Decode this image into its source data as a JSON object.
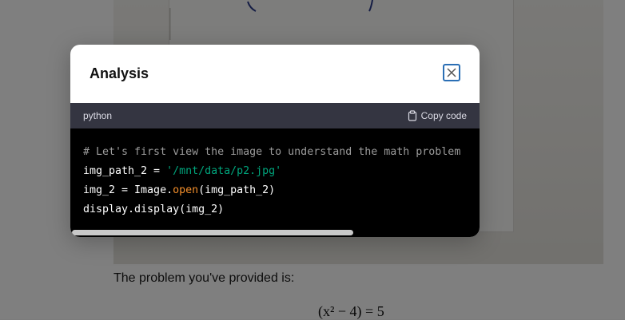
{
  "background": {
    "paragraph": "The problem you've provided is:",
    "math": "(x² − 4) = 5"
  },
  "modal": {
    "title": "Analysis",
    "close_icon": "close-icon"
  },
  "code_block": {
    "language": "python",
    "copy_label": "Copy code",
    "copy_icon": "clipboard-icon",
    "lines": {
      "l1_comment": "# Let's first view the image to understand the math problem",
      "l2_var": "img_path_2 = ",
      "l2_string": "'/mnt/data/p2.jpg'",
      "l3_pre": "img_2 = Image.",
      "l3_func": "open",
      "l3_post": "(img_path_2)",
      "l4": "display.display(img_2)"
    }
  },
  "colors": {
    "code_header_bg": "#343541",
    "code_bg": "#000000",
    "string": "#00a67d",
    "function": "#f28e2b",
    "comment": "#9b9b9b",
    "close_border": "#2b6fb5"
  }
}
